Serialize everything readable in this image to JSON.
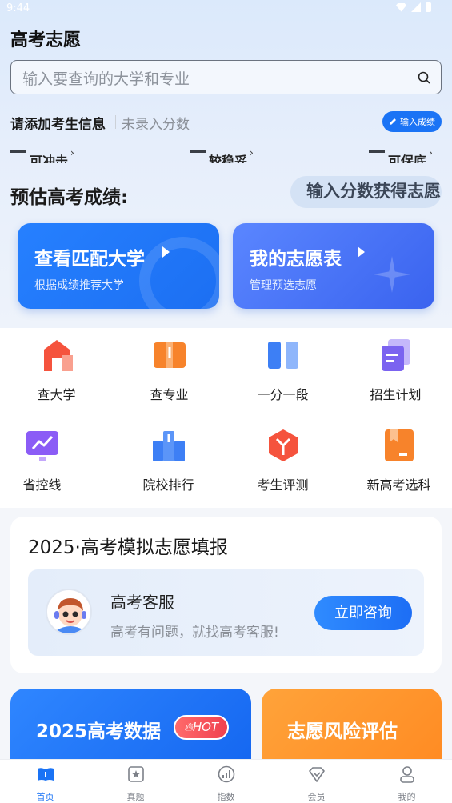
{
  "status_bar": {
    "time": "9:44"
  },
  "header": {
    "title": "高考志愿"
  },
  "search": {
    "placeholder": "输入要查询的大学和专业"
  },
  "info": {
    "label": "请添加考生信息",
    "sub": "未录入分数",
    "button": "输入成绩"
  },
  "tiers": [
    {
      "label": "可冲击"
    },
    {
      "label": "较稳妥"
    },
    {
      "label": "可保底"
    }
  ],
  "estimate": {
    "label": "预估高考成绩:",
    "pill": "输入分数获得志愿"
  },
  "cards": [
    {
      "title": "查看匹配大学",
      "subtitle": "根据成绩推荐大学"
    },
    {
      "title": "我的志愿表",
      "subtitle": "管理预选志愿"
    }
  ],
  "grid": [
    {
      "label": "查大学",
      "icon": "school-icon",
      "color": "#f5533d"
    },
    {
      "label": "查专业",
      "icon": "book-icon",
      "color": "#f7832b"
    },
    {
      "label": "一分一段",
      "icon": "score-segment-icon",
      "color": "#3d7ff5"
    },
    {
      "label": "招生计划",
      "icon": "plan-icon",
      "color": "#7b63f0"
    },
    {
      "label": "省控线",
      "icon": "line-chart-icon",
      "color": "#8b5cf6"
    },
    {
      "label": "院校排行",
      "icon": "ranking-icon",
      "color": "#3d7ff5"
    },
    {
      "label": "考生评测",
      "icon": "cube-icon",
      "color": "#f5533d"
    },
    {
      "label": "新高考选科",
      "icon": "bookmark-book-icon",
      "color": "#f7832b"
    }
  ],
  "simulation": {
    "title": "2025·高考模拟志愿填报",
    "service_title": "高考客服",
    "service_sub": "高考有问题，就找高考客服!",
    "consult_button": "立即咨询"
  },
  "bottom_cards": [
    {
      "title": "2025高考数据",
      "badge": "HOT"
    },
    {
      "title": "志愿风险评估"
    }
  ],
  "nav": [
    {
      "label": "首页",
      "icon": "home-icon",
      "active": true
    },
    {
      "label": "真题",
      "icon": "exam-icon"
    },
    {
      "label": "指数",
      "icon": "index-icon"
    },
    {
      "label": "会员",
      "icon": "vip-icon"
    },
    {
      "label": "我的",
      "icon": "profile-icon"
    }
  ],
  "colors": {
    "accent": "#1a73f5",
    "orange": "#ff8a22"
  }
}
